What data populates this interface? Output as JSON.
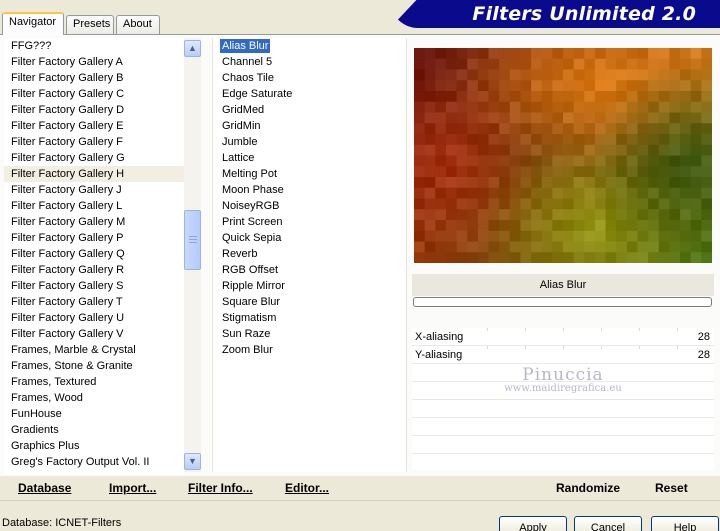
{
  "app": {
    "title": "Filters Unlimited 2.0"
  },
  "tabs": [
    {
      "label": "Navigator",
      "active": true
    },
    {
      "label": "Presets",
      "active": false
    },
    {
      "label": "About",
      "active": false
    }
  ],
  "categories": {
    "selected": "Filter Factory Gallery H",
    "items": [
      "FFG???",
      "Filter Factory Gallery A",
      "Filter Factory Gallery B",
      "Filter Factory Gallery C",
      "Filter Factory Gallery D",
      "Filter Factory Gallery E",
      "Filter Factory Gallery F",
      "Filter Factory Gallery G",
      "Filter Factory Gallery H",
      "Filter Factory Gallery J",
      "Filter Factory Gallery L",
      "Filter Factory Gallery M",
      "Filter Factory Gallery P",
      "Filter Factory Gallery Q",
      "Filter Factory Gallery R",
      "Filter Factory Gallery S",
      "Filter Factory Gallery T",
      "Filter Factory Gallery U",
      "Filter Factory Gallery V",
      "Frames, Marble & Crystal",
      "Frames, Stone & Granite",
      "Frames, Textured",
      "Frames, Wood",
      "FunHouse",
      "Gradients",
      "Graphics Plus",
      "Greg's Factory Output Vol. II"
    ]
  },
  "filters": {
    "selected": "Alias Blur",
    "items": [
      "Alias Blur",
      "Channel 5",
      "Chaos Tile",
      "Edge Saturate",
      "GridMed",
      "GridMin",
      "Jumble",
      "Lattice",
      "Melting Pot",
      "Moon Phase",
      "NoiseyRGB",
      "Print Screen",
      "Quick Sepia",
      "Reverb",
      "RGB Offset",
      "Ripple Mirror",
      "Square Blur",
      "Stigmatism",
      "Sun Raze",
      "Zoom Blur"
    ]
  },
  "preview": {
    "filter_name": "Alias Blur"
  },
  "params": [
    {
      "label": "X-aliasing",
      "value": "28"
    },
    {
      "label": "Y-aliasing",
      "value": "28"
    }
  ],
  "watermark": {
    "line1": "Pinuccia",
    "line2": "www.maidiregrafica.eu"
  },
  "links": {
    "database": "Database",
    "import": "Import...",
    "filter_info": "Filter Info...",
    "editor": "Editor...",
    "randomize": "Randomize",
    "reset": "Reset"
  },
  "status": {
    "database": "Database:  ICNET-Filters"
  },
  "buttons": {
    "apply": "Apply",
    "cancel": "Cancel",
    "help": "Help"
  },
  "colors": {
    "banner": "#0a0a8c",
    "selection": "#316ac5",
    "tab_accent": "#ffc73c"
  }
}
